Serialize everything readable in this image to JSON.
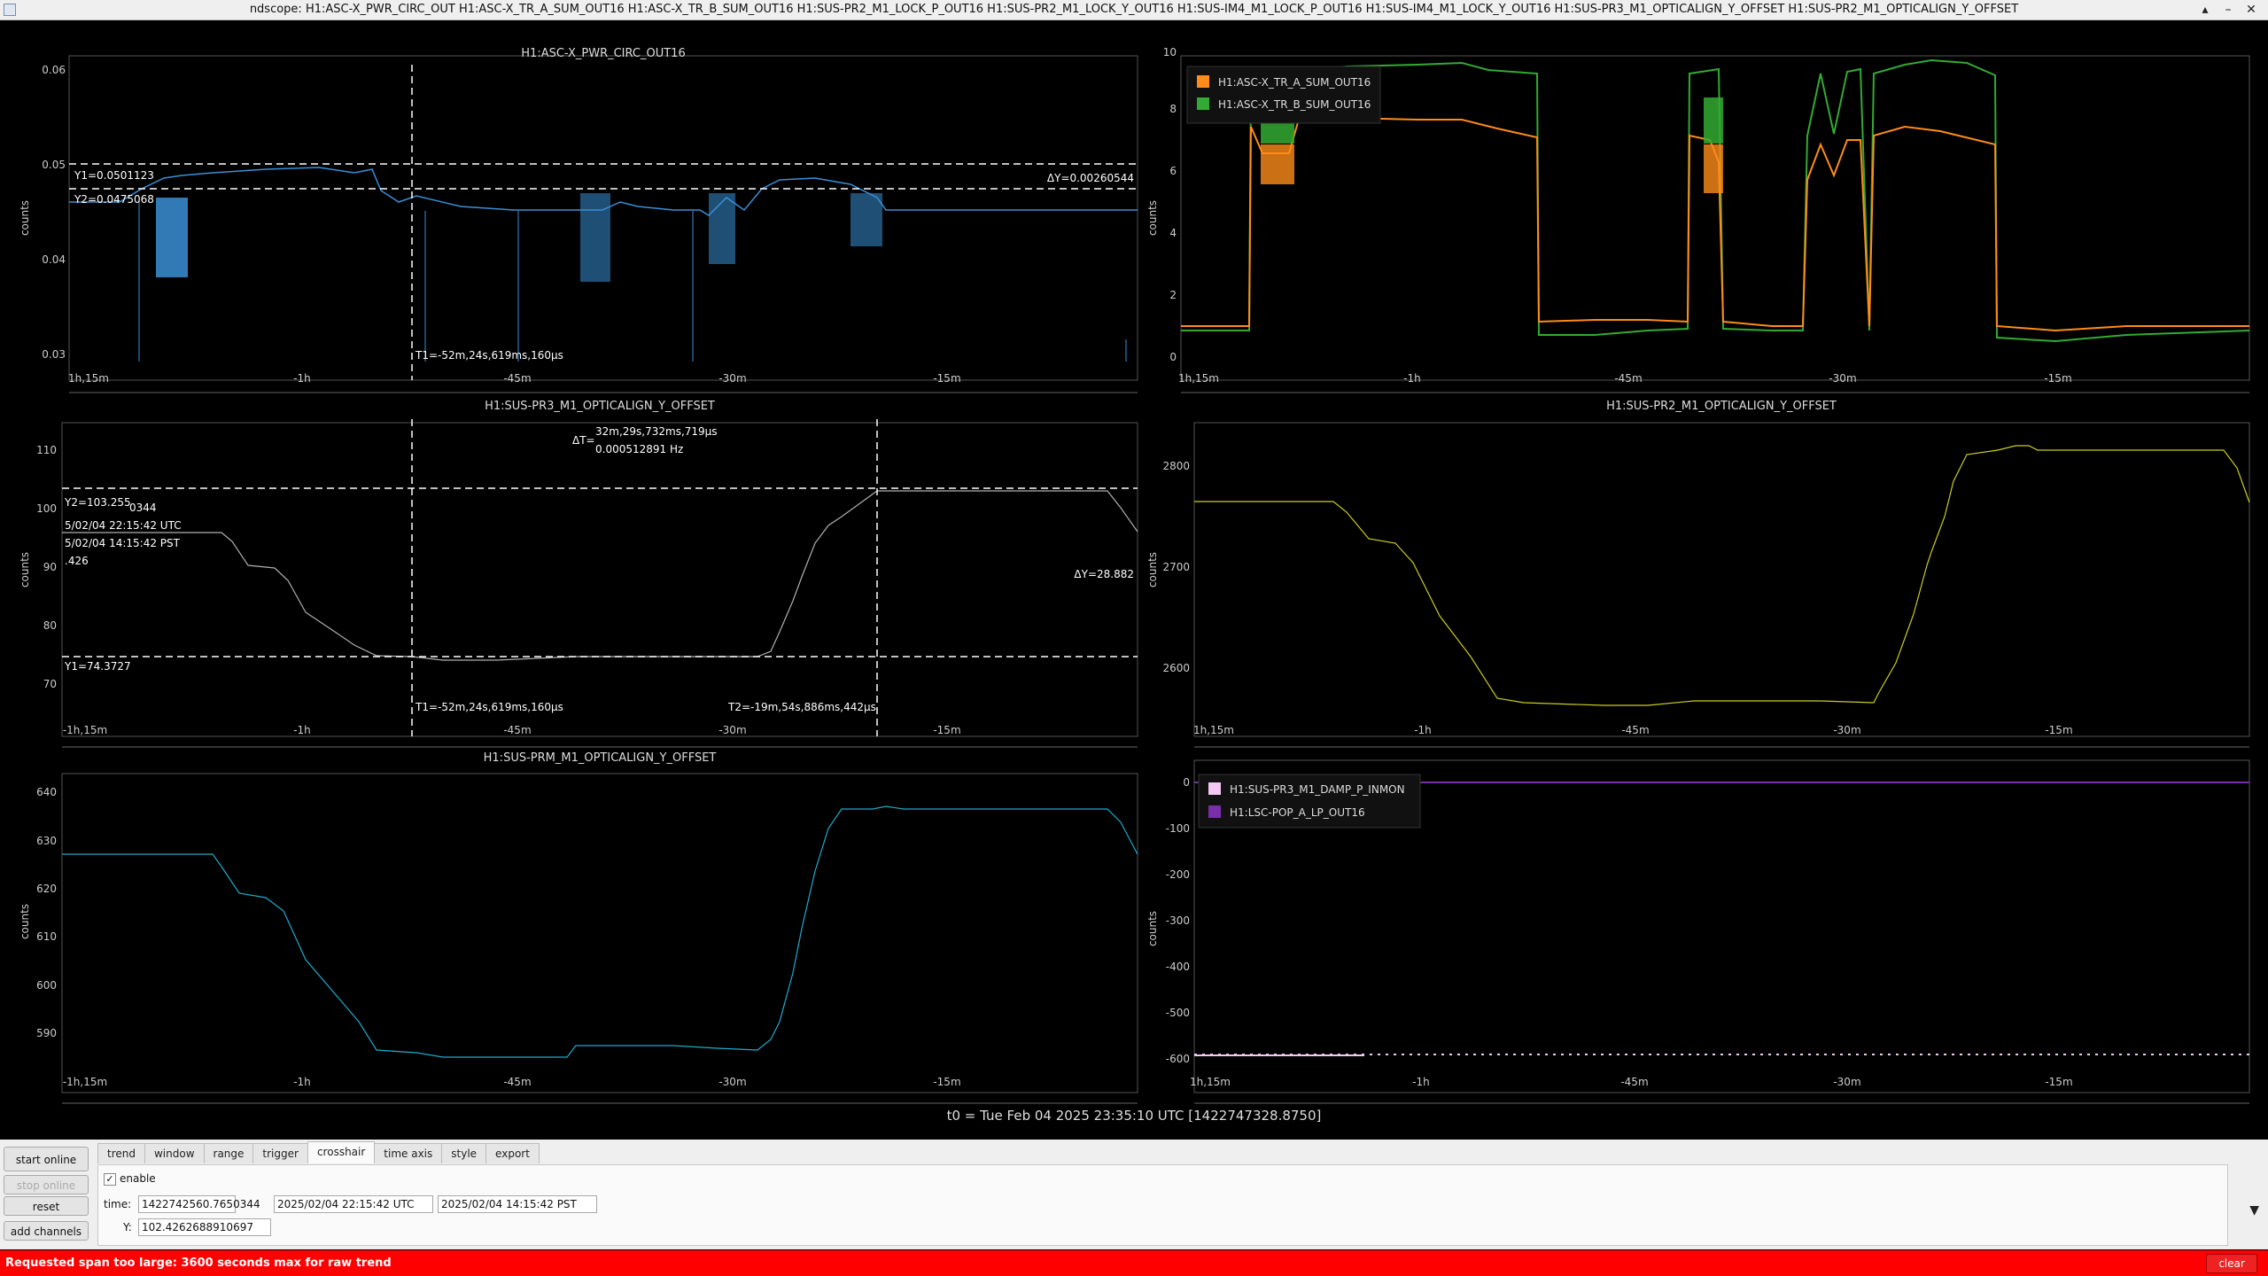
{
  "window": {
    "title": "ndscope: H1:ASC-X_PWR_CIRC_OUT H1:ASC-X_TR_A_SUM_OUT16 H1:ASC-X_TR_B_SUM_OUT16 H1:SUS-PR2_M1_LOCK_P_OUT16 H1:SUS-PR2_M1_LOCK_Y_OUT16 H1:SUS-IM4_M1_LOCK_P_OUT16 H1:SUS-IM4_M1_LOCK_Y_OUT16 H1:SUS-PR3_M1_OPTICALIGN_Y_OFFSET H1:SUS-PR2_M1_OPTICALIGN_Y_OFFSET",
    "controls": [
      "▴",
      "–",
      "✕"
    ]
  },
  "xticks": [
    "1h,15m",
    "-1h",
    "-45m",
    "-30m",
    "-15m"
  ],
  "ylabel": "counts",
  "plot1": {
    "title": "H1:ASC-X_PWR_CIRC_OUT16",
    "yticks": [
      "0.06",
      "0.05",
      "0.04",
      "0.03"
    ],
    "xticks": [
      "1h,15m",
      "-1h",
      "-45m",
      "-30m",
      "-15m"
    ],
    "y1": "Y1=0.0501123",
    "y2": "Y2=0.0475068",
    "dy": "ΔY=0.00260544",
    "t1": "T1=-52m,24s,619ms,160µs",
    "color": "#3a8fd6"
  },
  "plot2": {
    "yticks": [
      "10",
      "8",
      "6",
      "4",
      "2",
      "0"
    ],
    "xticks": [
      "1h,15m",
      "-1h",
      "-45m",
      "-30m",
      "-15m"
    ],
    "legend": [
      {
        "name": "H1:ASC-X_TR_A_SUM_OUT16",
        "color": "#ff8c1a"
      },
      {
        "name": "H1:ASC-X_TR_B_SUM_OUT16",
        "color": "#33aa33"
      }
    ]
  },
  "plot3": {
    "title": "H1:SUS-PR3_M1_OPTICALIGN_Y_OFFSET",
    "yticks": [
      "110",
      "100",
      "90",
      "80",
      "70"
    ],
    "xticks": [
      "-1h,15m",
      "-1h",
      "-45m",
      "-30m",
      "-15m"
    ],
    "y1": "Y1=74.3727",
    "y2": "Y2=103.255",
    "dy": "ΔY=28.882",
    "t1": "T1=-52m,24s,619ms,160µs",
    "t2": "T2=-19m,54s,886ms,442µs",
    "dt_label": "ΔT=",
    "dt_value": "32m,29s,732ms,719µs",
    "dt_freq": "0.000512891 Hz",
    "info": [
      "0344",
      "5/02/04 22:15:42 UTC",
      "5/02/04 14:15:42 PST",
      ".426"
    ],
    "color": "#b0b0b0"
  },
  "plot4": {
    "title": "H1:SUS-PR2_M1_OPTICALIGN_Y_OFFSET",
    "yticks": [
      "2800",
      "2700",
      "2600"
    ],
    "xticks": [
      "1h,15m",
      "-1h",
      "-45m",
      "-30m",
      "-15m"
    ],
    "color": "#cccc22"
  },
  "plot5": {
    "title": "H1:SUS-PRM_M1_OPTICALIGN_Y_OFFSET",
    "yticks": [
      "640",
      "630",
      "620",
      "610",
      "600",
      "590"
    ],
    "xticks": [
      "-1h,15m",
      "-1h",
      "-45m",
      "-30m",
      "-15m"
    ],
    "color": "#22aacc"
  },
  "plot6": {
    "yticks": [
      "0",
      "-100",
      "-200",
      "-300",
      "-400",
      "-500",
      "-600"
    ],
    "xticks": [
      "1h,15m",
      "-1h",
      "-45m",
      "-30m",
      "-15m"
    ],
    "legend": [
      {
        "name": "H1:SUS-PR3_M1_DAMP_P_INMON",
        "color": "#f2c8f2"
      },
      {
        "name": "H1:LSC-POP_A_LP_OUT16",
        "color": "#7a2ea8"
      }
    ]
  },
  "t0": "t0 = Tue Feb 04 2025 23:35:10 UTC [1422747328.8750]",
  "buttons": {
    "start_online": "start online",
    "stop_online": "stop online",
    "reset": "reset",
    "add_channels": "add channels"
  },
  "tabs": [
    "trend",
    "window",
    "range",
    "trigger",
    "crosshair",
    "time axis",
    "style",
    "export"
  ],
  "crosshair": {
    "enable": "enable",
    "time_label": "time:",
    "gps": "1422742560.7650344",
    "utc": "2025/02/04 22:15:42 UTC",
    "pst": "2025/02/04 14:15:42 PST",
    "y_label": "Y:",
    "y_value": "102.4262688910697"
  },
  "status": {
    "message": "Requested span too large: 3600 seconds max for raw trend",
    "clear": "clear"
  }
}
